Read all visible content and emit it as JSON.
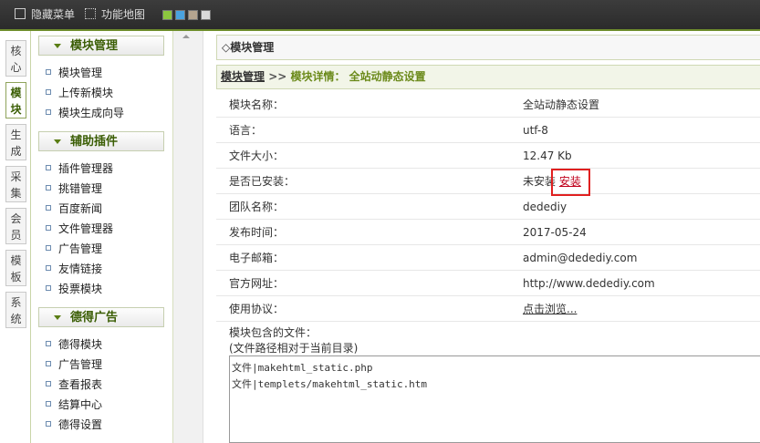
{
  "topbar": {
    "hide_menu": "隐藏菜单",
    "function_map": "功能地图",
    "skin_colors": [
      "#8cc63f",
      "#4aa3df",
      "#b4a48f",
      "#d9d9d9"
    ]
  },
  "left_tabs": [
    {
      "label": "核心",
      "active": false
    },
    {
      "label": "模块",
      "active": true
    },
    {
      "label": "生成",
      "active": false
    },
    {
      "label": "采集",
      "active": false
    },
    {
      "label": "会员",
      "active": false
    },
    {
      "label": "模板",
      "active": false
    },
    {
      "label": "系统",
      "active": false
    }
  ],
  "menu": {
    "groups": [
      {
        "title": "模块管理",
        "items": [
          "模块管理",
          "上传新模块",
          "模块生成向导"
        ]
      },
      {
        "title": "辅助插件",
        "items": [
          "插件管理器",
          "挑错管理",
          "百度新闻",
          "文件管理器",
          "广告管理",
          "友情链接",
          "投票模块"
        ]
      },
      {
        "title": "德得广告",
        "items": [
          "德得模块",
          "广告管理",
          "查看报表",
          "结算中心",
          "德得设置"
        ]
      }
    ]
  },
  "panel": {
    "title": "◇模块管理"
  },
  "breadcrumb": {
    "link": "模块管理",
    "sep": " >> ",
    "detail": "模块详情： 全站动静态设置"
  },
  "details": {
    "rows": [
      {
        "label": "模块名称：",
        "value": "全站动静态设置"
      },
      {
        "label": "语言：",
        "value": "utf-8"
      },
      {
        "label": "文件大小：",
        "value": "12.47 Kb"
      },
      {
        "label": "是否已安装：",
        "value": "未安装",
        "link": "安装"
      },
      {
        "label": "团队名称：",
        "value": "dedediy"
      },
      {
        "label": "发布时间：",
        "value": "2017-05-24"
      },
      {
        "label": "电子邮箱：",
        "value": "admin@dedediy.com"
      },
      {
        "label": "官方网址：",
        "value": "http://www.dedediy.com"
      },
      {
        "label": "使用协议：",
        "link": "点击浏览..."
      }
    ]
  },
  "files": {
    "label_line1": "模块包含的文件：",
    "label_line2": "(文件路径相对于当前目录)",
    "lines": [
      "文件|makehtml_static.php",
      "文件|templets/makehtml_static.htm"
    ]
  }
}
